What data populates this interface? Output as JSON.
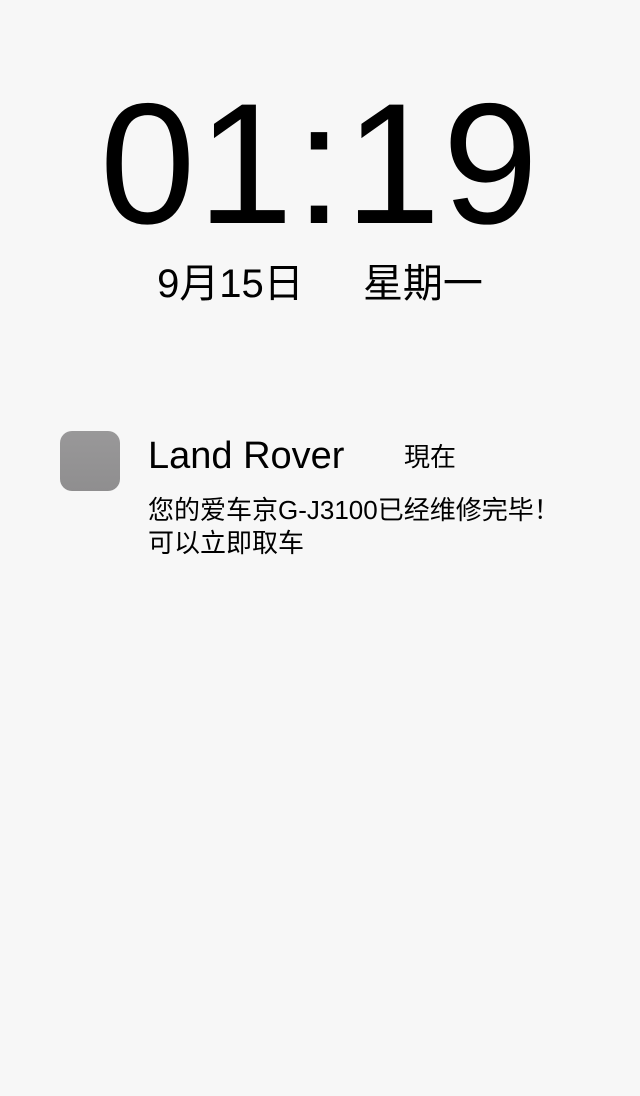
{
  "lockscreen": {
    "time": "01:19",
    "date": "9月15日",
    "weekday": "星期一"
  },
  "notification": {
    "app_name": "Land Rover",
    "time_label": "現在",
    "message": "您的爱车京G-J3100已经维修完毕！可以立即取车",
    "icon": "app-icon-placeholder",
    "icon_color": "#969596"
  },
  "colors": {
    "background": "#f7f7f7",
    "text": "#000000"
  }
}
